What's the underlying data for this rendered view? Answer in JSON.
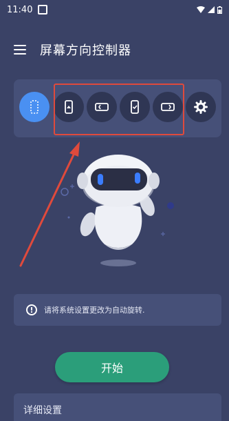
{
  "status_bar": {
    "time": "11:40"
  },
  "app_bar": {
    "title": "屏幕方向控制器"
  },
  "mode_buttons": [
    {
      "name": "auto-rotate",
      "icon": "portrait-dotted-icon",
      "active": true
    },
    {
      "name": "portrait",
      "icon": "portrait-locked-icon",
      "active": false
    },
    {
      "name": "landscape",
      "icon": "landscape-icon",
      "active": false
    },
    {
      "name": "portrait-reverse",
      "icon": "portrait-check-icon",
      "active": false
    },
    {
      "name": "landscape-reverse",
      "icon": "landscape-reverse-icon",
      "active": false
    },
    {
      "name": "settings",
      "icon": "gear-icon",
      "active": false
    }
  ],
  "hint": {
    "text": "请将系统设置更改为自动旋转."
  },
  "start_button": {
    "label": "开始"
  },
  "details": {
    "label": "详细设置"
  },
  "colors": {
    "background": "#3a4266",
    "card": "#465078",
    "active": "#4a90f2",
    "start": "#2b9e7a",
    "annotation": "#e04a3c"
  }
}
